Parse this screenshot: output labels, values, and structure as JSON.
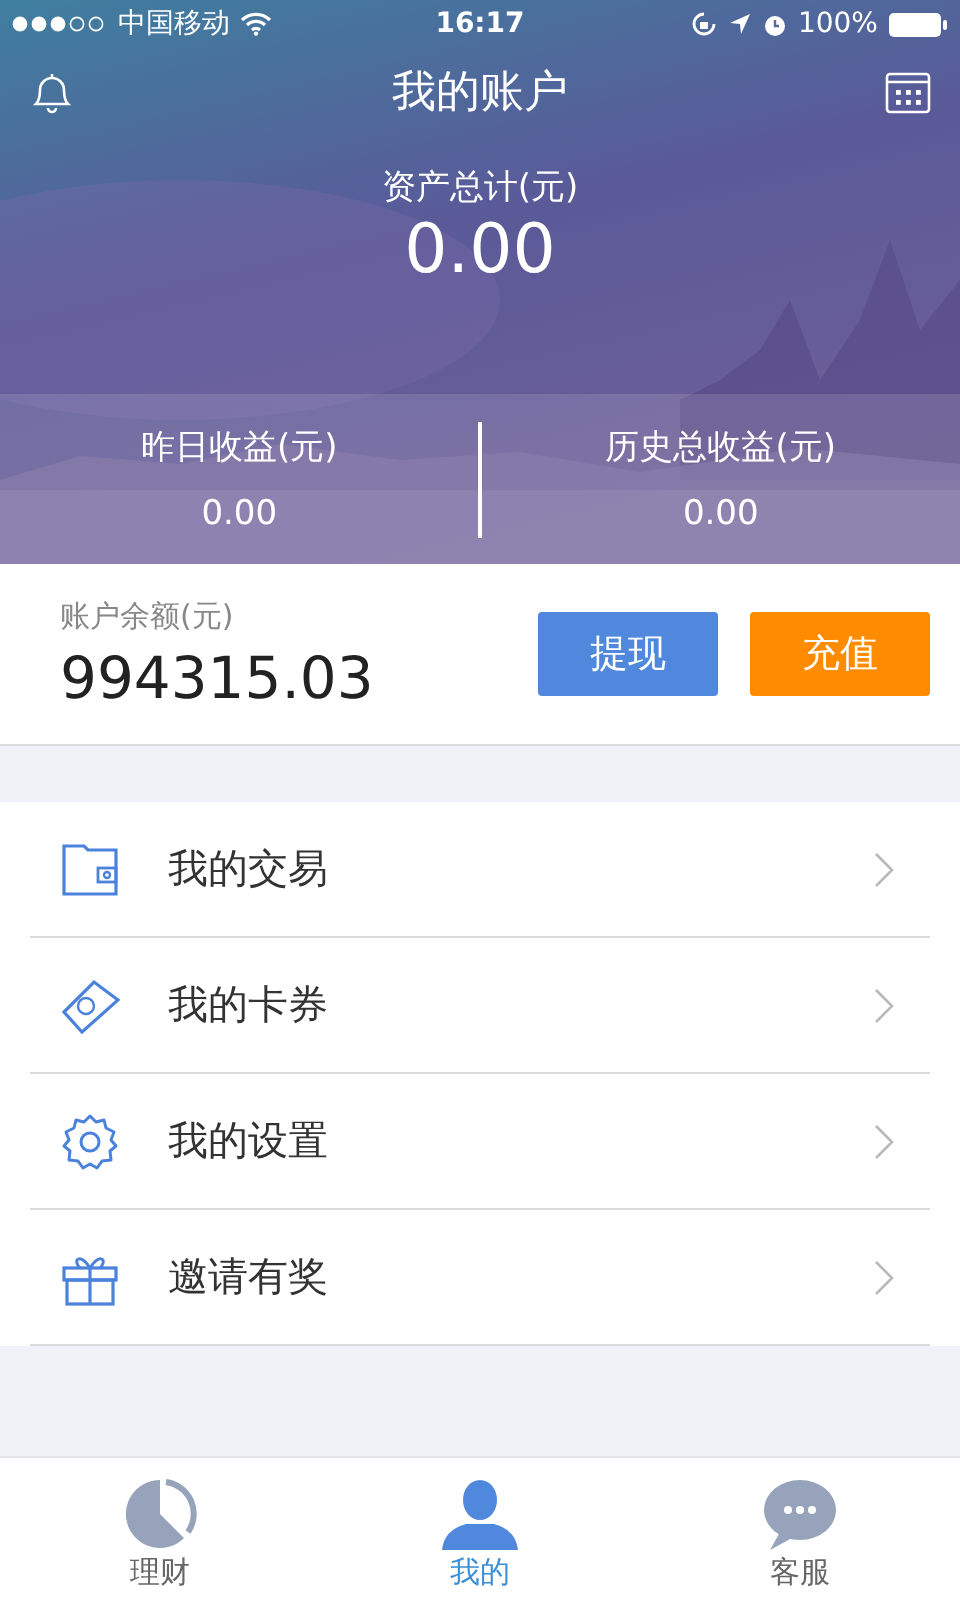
{
  "status_bar": {
    "carrier": "中国移动",
    "time": "16:17",
    "battery": "100%"
  },
  "header": {
    "title": "我的账户",
    "total_label": "资产总计(元)",
    "total_value": "0.00",
    "stats": [
      {
        "label": "昨日收益(元)",
        "value": "0.00"
      },
      {
        "label": "历史总收益(元)",
        "value": "0.00"
      }
    ]
  },
  "balance": {
    "label": "账户余额(元)",
    "value": "994315.03",
    "buttons": [
      {
        "label": "提现",
        "kind": "withdraw"
      },
      {
        "label": "充值",
        "kind": "recharge"
      }
    ]
  },
  "menu": [
    {
      "label": "我的交易"
    },
    {
      "label": "我的卡券"
    },
    {
      "label": "我的设置"
    },
    {
      "label": "邀请有奖"
    }
  ],
  "tab_bar": [
    {
      "label": "理财",
      "selected": false
    },
    {
      "label": "我的",
      "selected": true
    },
    {
      "label": "客服",
      "selected": false
    }
  ]
}
